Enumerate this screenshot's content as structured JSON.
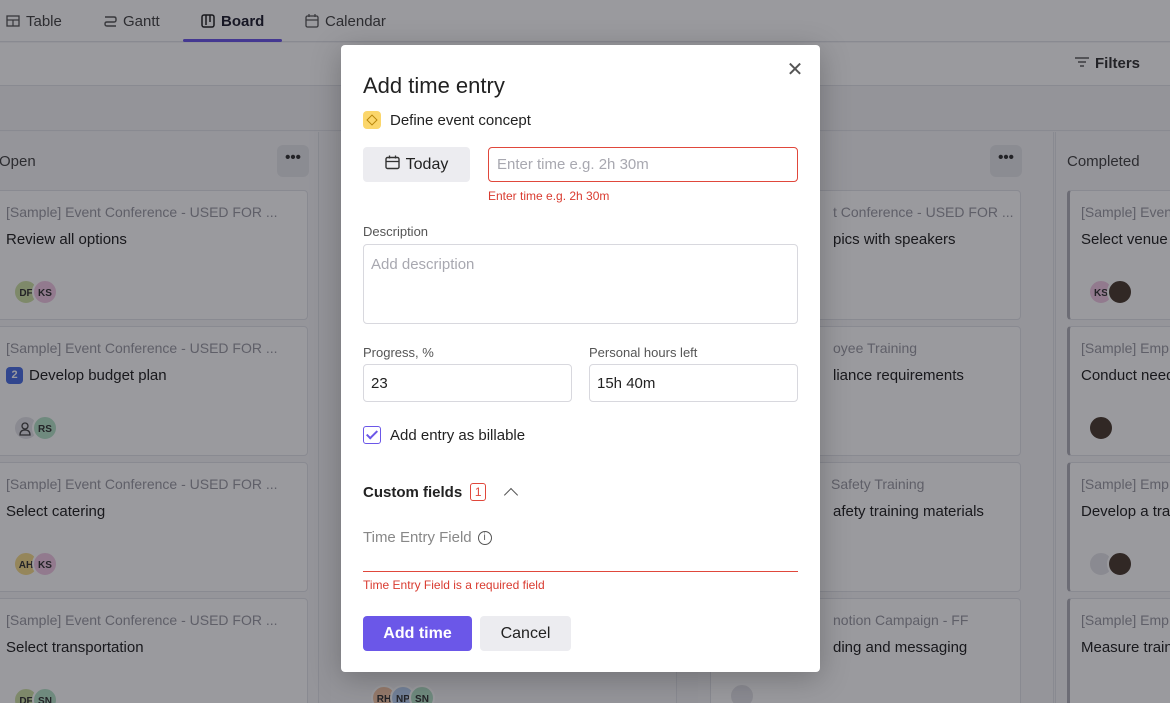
{
  "tabs": [
    {
      "label": "Table",
      "icon": "table-icon"
    },
    {
      "label": "Gantt",
      "icon": "gantt-icon"
    },
    {
      "label": "Board",
      "icon": "board-icon",
      "active": true
    },
    {
      "label": "Calendar",
      "icon": "calendar-icon"
    }
  ],
  "toolbar": {
    "filters_label": "Filters"
  },
  "board": {
    "columns": [
      {
        "title": "Open",
        "menu": "•••",
        "cards": [
          {
            "project": "[Sample] Event Conference - USED FOR ...",
            "title": "Review all options",
            "avatars": [
              "DF",
              "KS"
            ]
          },
          {
            "project": "[Sample] Event Conference - USED FOR ...",
            "badge": "2",
            "title": "Develop budget plan",
            "avatars": [
              "RS"
            ]
          },
          {
            "project": "[Sample] Event Conference - USED FOR ...",
            "title": "Select catering",
            "avatars": [
              "AH",
              "KS"
            ]
          },
          {
            "project": "[Sample] Event Conference - USED FOR ...",
            "title": "Select transportation",
            "avatars": [
              "DF",
              "SN"
            ]
          }
        ]
      },
      {
        "title": "",
        "menu": "•••",
        "cards": [
          {
            "project": "t Conference - USED FOR ...",
            "title": "pics with speakers"
          },
          {
            "project": "oyee Training",
            "title": "liance requirements"
          },
          {
            "project": "Safety Training",
            "title": "afety training materials"
          },
          {
            "project": "notion Campaign - FF",
            "title": "ding and messaging"
          }
        ]
      },
      {
        "title": "Completed",
        "cards": [
          {
            "project": "[Sample] Even",
            "title": "Select venue",
            "avatars": [
              "KS"
            ]
          },
          {
            "project": "[Sample] Emp",
            "title": "Conduct need"
          },
          {
            "project": "[Sample] Emp",
            "title": "Develop a tra"
          },
          {
            "project": "[Sample] Emp",
            "title": "Measure train"
          }
        ]
      }
    ],
    "hidden_column_avatars": [
      "RH",
      "NP",
      "SN"
    ]
  },
  "modal": {
    "title": "Add time entry",
    "close_icon": "close-icon",
    "task_name": "Define event concept",
    "today_label": "Today",
    "time_placeholder": "Enter time e.g. 2h 30m",
    "time_error": "Enter time e.g. 2h 30m",
    "description_label": "Description",
    "description_placeholder": "Add description",
    "progress_label": "Progress, %",
    "progress_value": "23",
    "hours_left_label": "Personal hours left",
    "hours_left_value": "15h 40m",
    "billable_label": "Add entry as billable",
    "billable_checked": true,
    "custom_fields_label": "Custom fields",
    "custom_fields_count": "1",
    "time_entry_field_label": "Time Entry Field",
    "time_entry_field_error": "Time Entry Field is a required field",
    "add_button": "Add time",
    "cancel_button": "Cancel"
  },
  "colors": {
    "accent": "#6b57e8",
    "error": "#e0473b"
  }
}
